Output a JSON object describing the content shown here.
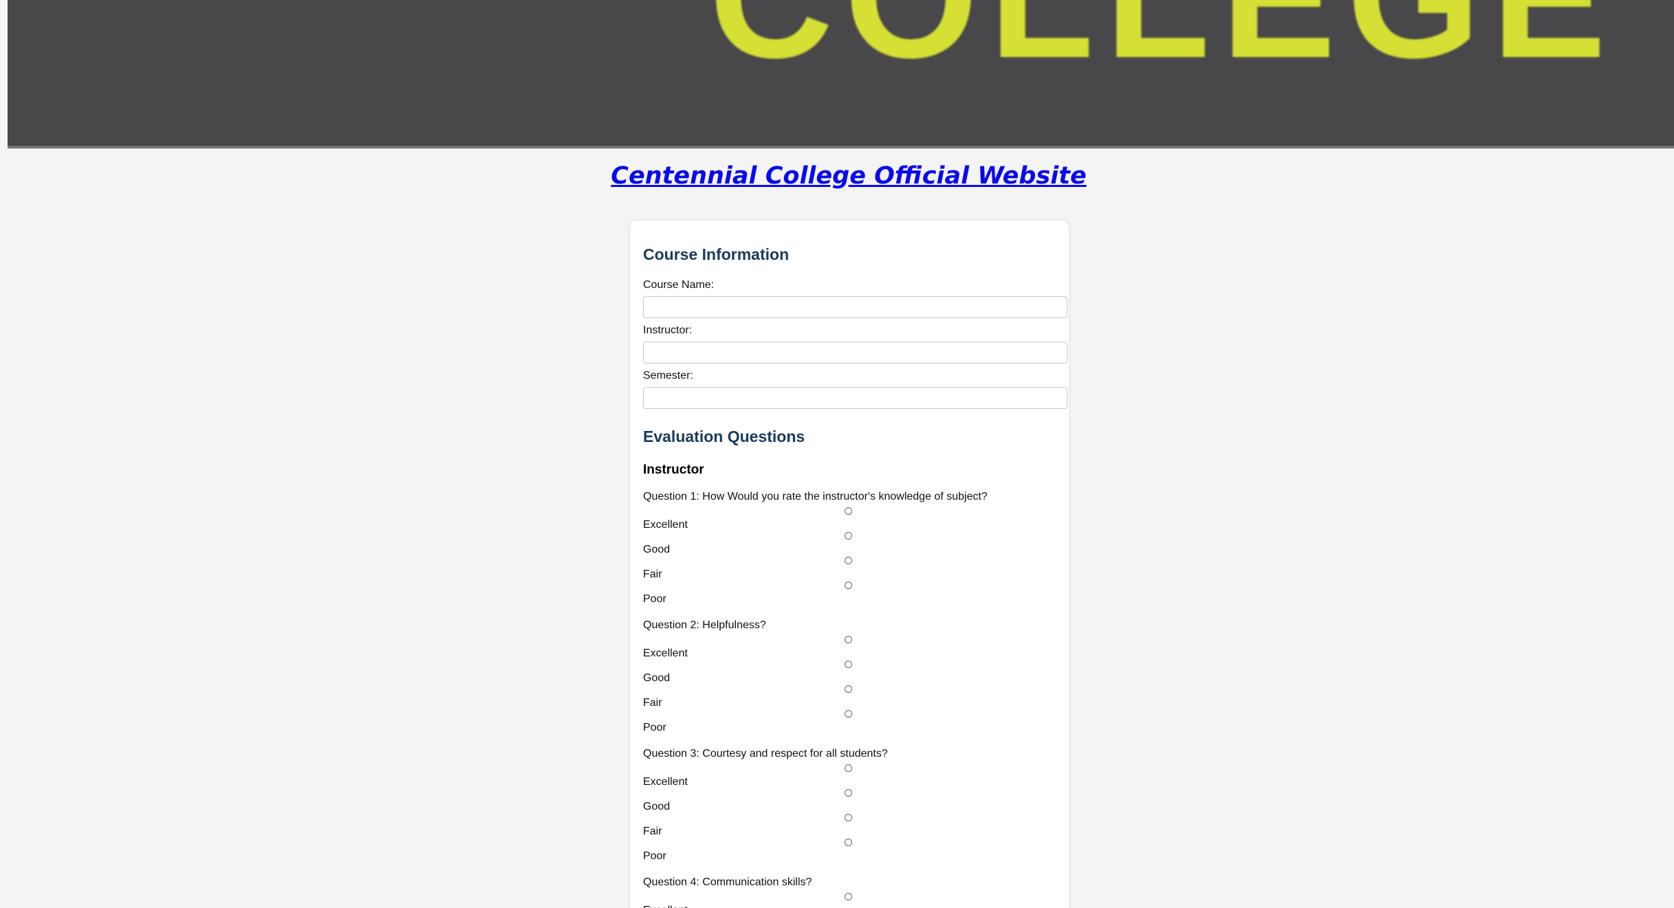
{
  "banner": {
    "logo_text": "COLLEGE"
  },
  "site_link": {
    "label": "Centennial College Official Website"
  },
  "course_info": {
    "title": "Course Information",
    "fields": [
      {
        "label": "Course Name:",
        "value": ""
      },
      {
        "label": "Instructor:",
        "value": ""
      },
      {
        "label": "Semester:",
        "value": ""
      }
    ]
  },
  "evaluation": {
    "title": "Evaluation Questions",
    "subsection": "Instructor",
    "options": [
      "Excellent",
      "Good",
      "Fair",
      "Poor"
    ],
    "questions": [
      {
        "text": "Question 1: How Would you rate the instructor's knowledge of subject?"
      },
      {
        "text": "Question 2: Helpfulness?"
      },
      {
        "text": "Question 3: Courtesy and respect for all students?"
      },
      {
        "text": "Question 4: Communication skills?"
      }
    ]
  },
  "colors": {
    "banner_bg": "#48484a",
    "logo": "#d5df34",
    "link": "#0a0aee",
    "heading": "#1a3a5c"
  }
}
